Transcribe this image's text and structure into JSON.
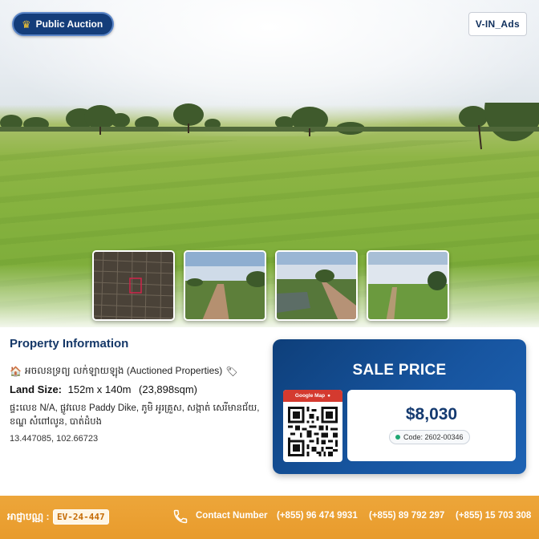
{
  "hero": {
    "auction_badge": "Public Auction",
    "brand_badge": "V-IN_Ads",
    "thumbnails": [
      {
        "icon": "satellite-map-thumbnail"
      },
      {
        "icon": "dirt-road-thumbnail"
      },
      {
        "icon": "road-with-pond-thumbnail"
      },
      {
        "icon": "open-field-thumbnail"
      }
    ]
  },
  "info": {
    "title": "Property Information",
    "type_text": "អចលនទ្រព្យ លក់ឡាយឡុង (Auctioned Properties)",
    "size_label": "Land Size:",
    "size_dims": "152m x 140m",
    "size_area": "(23,898sqm)",
    "address": "ផ្ទះលេខ N/A, ផ្លូវលេខ Paddy Dike, ភូមិ អូរគ្រួស, សង្កាត់ សេរីមានជ័យ, ខណ្ឌ សំពៅលូន, បាត់ដំបង",
    "coords": "13.447085, 102.66723"
  },
  "sale": {
    "title": "SALE PRICE",
    "qr_label": "Google Map",
    "price": "$8,030",
    "code": "Code: 2602-00346"
  },
  "footer": {
    "code_label": "អាជ្ញាបណ្ណ :",
    "code_value": "EV-24-447",
    "contact_label": "Contact Number",
    "phones": [
      "(+855) 96 474 9931",
      "(+855) 89 792 297",
      "(+855) 15 703 308"
    ]
  },
  "colors": {
    "brand_navy": "#143d7a",
    "footer_orange": "#e89b2c",
    "qr_red": "#d43a2f",
    "code_dot_green": "#1ea672"
  }
}
